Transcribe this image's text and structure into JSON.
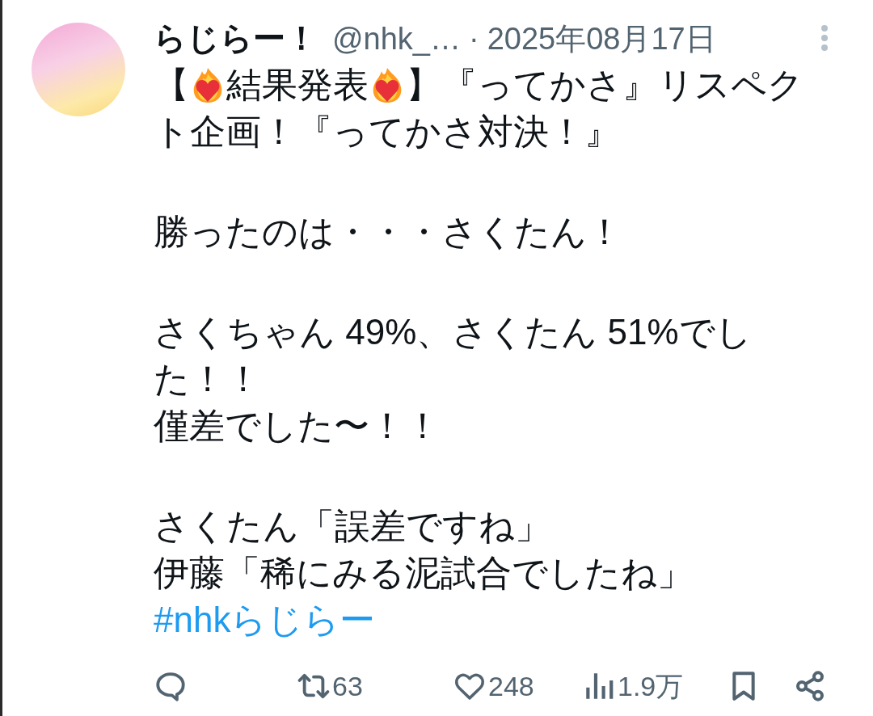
{
  "author": {
    "name": "らじらー！",
    "handle": "@nhk_…",
    "separator": "·",
    "date": "2025年08月17日"
  },
  "body": [
    {
      "kind": "segments",
      "lines": [
        [
          {
            "kind": "text",
            "text": "【"
          },
          {
            "kind": "emoji"
          },
          {
            "kind": "text",
            "text": "結果発表"
          },
          {
            "kind": "emoji"
          },
          {
            "kind": "text",
            "text": "】『ってかさ』リスペク"
          }
        ],
        [
          {
            "kind": "text",
            "text": "ト企画！『ってかさ対決！』"
          }
        ]
      ]
    },
    {
      "kind": "plain",
      "lines": [
        "勝ったのは・・・さくたん！"
      ]
    },
    {
      "kind": "plain",
      "lines": [
        "さくちゃん 49%、さくたん 51%でし",
        "た！！",
        "僅差でした〜！！"
      ]
    },
    {
      "kind": "plain",
      "lines": [
        "さくたん「誤差ですね」",
        "伊藤「稀にみる泥試合でしたね」"
      ]
    }
  ],
  "hashtag": "#nhkらじらー",
  "actions": [
    {
      "kind": "reply"
    },
    {
      "kind": "repost",
      "count": "63"
    },
    {
      "kind": "like",
      "count": "248"
    },
    {
      "kind": "views",
      "count": "1.9万"
    },
    {
      "kind": "bookmark"
    },
    {
      "kind": "share"
    }
  ]
}
